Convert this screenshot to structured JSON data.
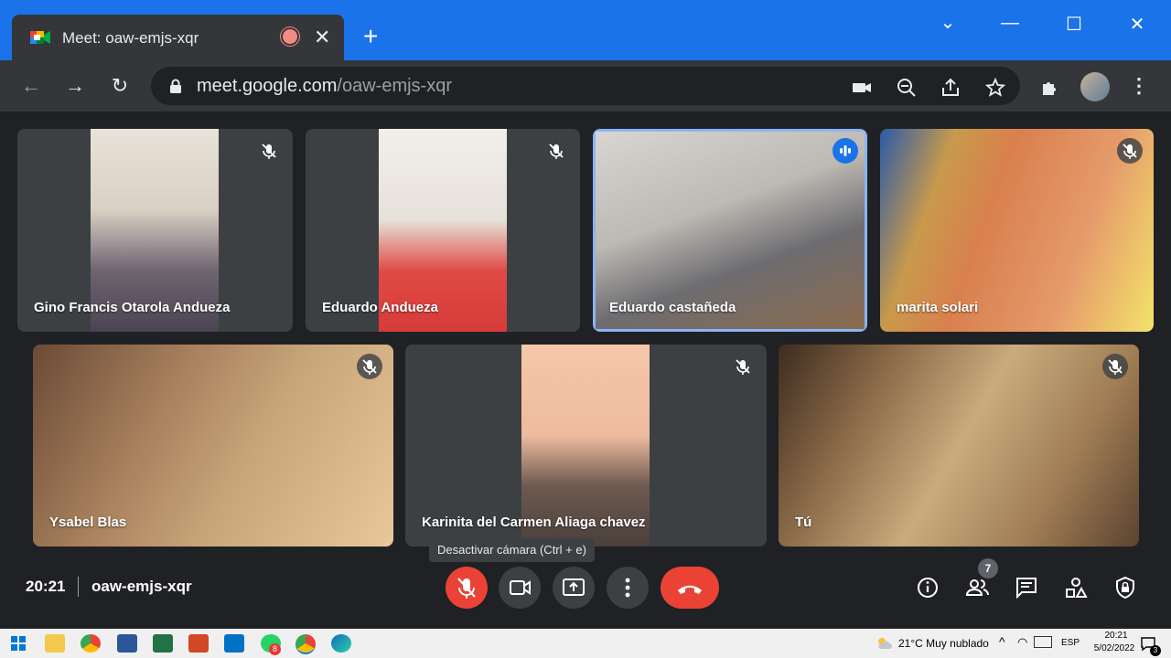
{
  "browser": {
    "tab_title": "Meet: oaw-emjs-xqr",
    "url_host": "meet.google.com",
    "url_path": "/oaw-emjs-xqr"
  },
  "participants": [
    {
      "name": "Gino Francis Otarola Andueza",
      "muted": true
    },
    {
      "name": "Eduardo Andueza",
      "muted": true
    },
    {
      "name": "Eduardo castañeda",
      "muted": false,
      "speaking": true
    },
    {
      "name": "marita solari",
      "muted": true
    },
    {
      "name": "Ysabel Blas",
      "muted": true
    },
    {
      "name": "Karinita del Carmen Aliaga chavez",
      "muted": true
    },
    {
      "name": "Tú",
      "muted": true
    }
  ],
  "tooltip": "Desactivar cámara (Ctrl + e)",
  "meeting": {
    "time": "20:21",
    "code": "oaw-emjs-xqr",
    "people_count": "7"
  },
  "taskbar": {
    "weather": "21°C  Muy nublado",
    "language": "ESP",
    "time": "20:21",
    "date": "5/02/2022",
    "whatsapp_badge": "8",
    "notification_count": "3"
  },
  "colors": {
    "accent": "#1a73e8",
    "danger": "#ea4335",
    "tile_bg": "#3c4043",
    "page_bg": "#202124"
  }
}
